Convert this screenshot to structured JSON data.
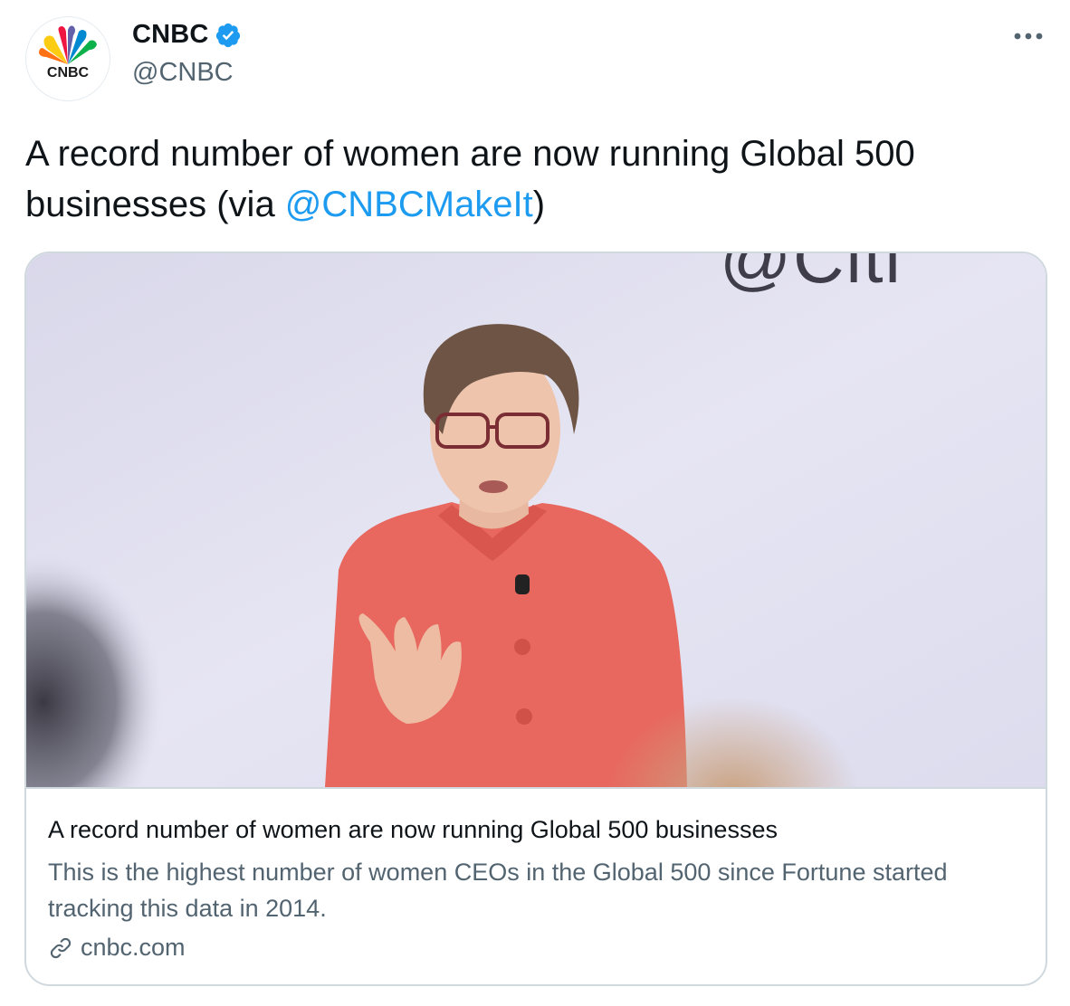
{
  "account": {
    "display_name": "CNBC",
    "handle": "@CNBC",
    "avatar_logo_text": "CNBC",
    "verified": true
  },
  "tweet": {
    "text_before": "A record number of women are now running Global 500 businesses (via ",
    "mention": "@CNBCMakeIt",
    "text_after": ")"
  },
  "card": {
    "image_backdrop_text": "@Citi",
    "title": "A record number of women are now running Global 500 businesses",
    "description": "This is the highest number of women CEOs in the Global 500 since Fortune started tracking this data in 2014.",
    "domain": "cnbc.com"
  },
  "icons": {
    "verified": "verified-badge-icon",
    "more": "more-options-icon",
    "link": "link-icon"
  },
  "colors": {
    "link": "#1d9bf0",
    "secondary_text": "#536471",
    "border": "#cfd9de"
  }
}
